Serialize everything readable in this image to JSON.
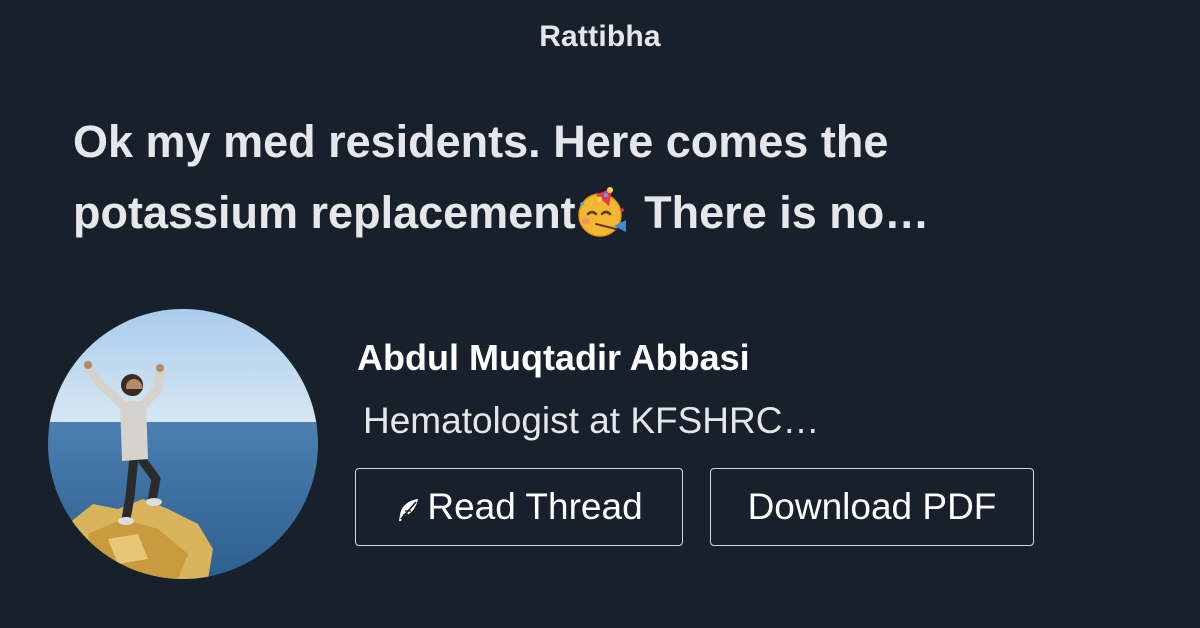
{
  "brand": "Rattibha",
  "thread": {
    "title_line1": "Ok my med residents. Here comes the",
    "title_line2_before": "potassium replacement",
    "title_emoji": "partying-face-emoji",
    "title_line2_after": " There is no…"
  },
  "author": {
    "name": "Abdul Muqtadir Abbasi",
    "bio": "Hematologist at KFSHRC…",
    "avatar_icon": "profile-photo"
  },
  "actions": {
    "read_label": "Read Thread",
    "read_icon": "feather-icon",
    "pdf_label": "Download PDF"
  },
  "colors": {
    "background": "#18202b",
    "text": "#e6e7ea",
    "button_border": "#d4d7dc"
  }
}
